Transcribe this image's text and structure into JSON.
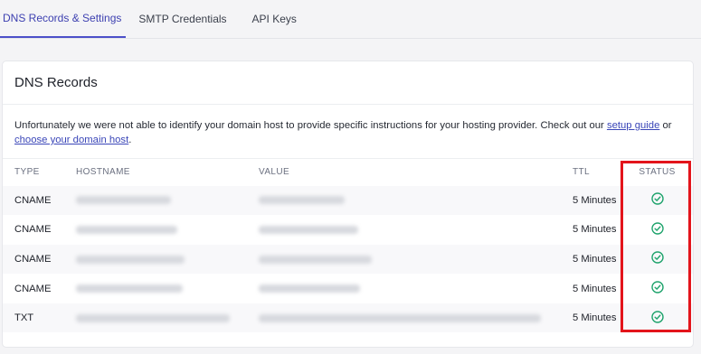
{
  "tabs": [
    {
      "label": "DNS Records & Settings"
    },
    {
      "label": "SMTP Credentials"
    },
    {
      "label": "API Keys"
    }
  ],
  "card": {
    "title": "DNS Records",
    "notice_text": "Unfortunately we were not able to identify your domain host to provide specific instructions for your hosting provider. Check out our ",
    "notice_link1": "setup guide",
    "notice_or": " or ",
    "notice_link2": "choose your domain host",
    "notice_end": "."
  },
  "table": {
    "headers": {
      "type": "TYPE",
      "hostname": "HOSTNAME",
      "value": "VALUE",
      "ttl": "TTL",
      "status": "STATUS"
    },
    "rows": [
      {
        "type": "CNAME",
        "ttl": "5 Minutes",
        "status_icon": "check-circle-icon"
      },
      {
        "type": "CNAME",
        "ttl": "5 Minutes",
        "status_icon": "check-circle-icon"
      },
      {
        "type": "CNAME",
        "ttl": "5 Minutes",
        "status_icon": "check-circle-icon"
      },
      {
        "type": "CNAME",
        "ttl": "5 Minutes",
        "status_icon": "check-circle-icon"
      },
      {
        "type": "TXT",
        "ttl": "5 Minutes",
        "status_icon": "check-circle-icon"
      }
    ]
  },
  "colors": {
    "accent": "#4c4fc9",
    "status_ok": "#1fa36c",
    "highlight": "#e3141b"
  }
}
